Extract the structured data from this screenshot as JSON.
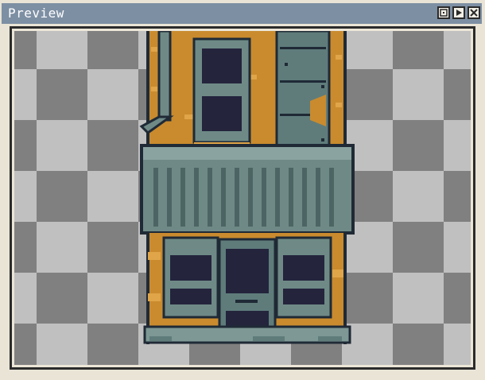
{
  "window": {
    "title": "Preview"
  },
  "buttons": {
    "fit": "fit-icon",
    "play": "play-icon",
    "close": "close-icon"
  },
  "colors": {
    "titlebar": "#7d8fa3",
    "checker_light": "#c0c0c0",
    "checker_dark": "#808080",
    "brick": "#c98b2e",
    "metal": "#6f8a86",
    "outline": "#1f2a36",
    "window_glass": "#24243d"
  }
}
